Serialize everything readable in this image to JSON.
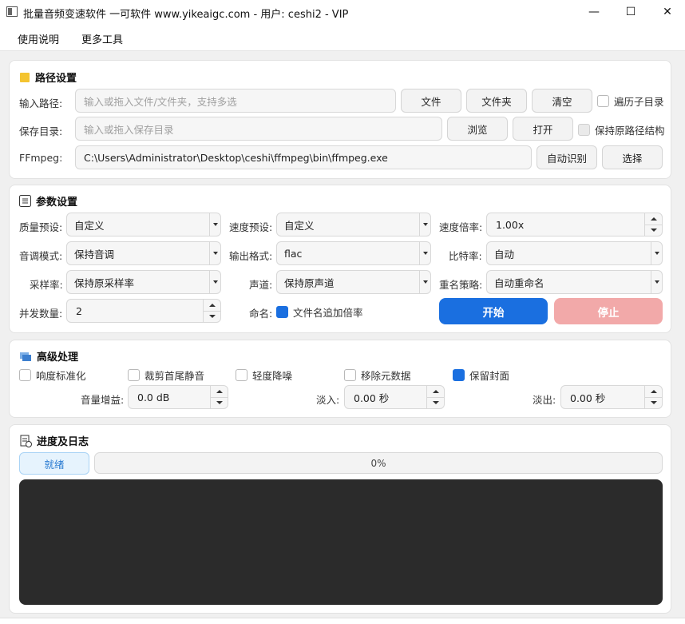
{
  "window": {
    "title": "批量音频变速软件 一可软件 www.yikeaigc.com - 用户: ceshi2 - VIP",
    "minimize": "—",
    "maximize": "☐",
    "close": "✕"
  },
  "menu": {
    "items": [
      "使用说明",
      "更多工具"
    ]
  },
  "path": {
    "title": "路径设置",
    "input_label": "输入路径:",
    "input_placeholder": "输入或拖入文件/文件夹，支持多选",
    "file_btn": "文件",
    "folder_btn": "文件夹",
    "clear_btn": "清空",
    "recursive_label": "遍历子目录",
    "recursive_checked": false,
    "save_label": "保存目录:",
    "save_placeholder": "输入或拖入保存目录",
    "browse_btn": "浏览",
    "open_btn": "打开",
    "keep_structure_label": "保持原路径结构",
    "keep_structure_checked": false,
    "ffmpeg_label": "FFmpeg:",
    "ffmpeg_value": "C:\\Users\\Administrator\\Desktop\\ceshi\\ffmpeg\\bin\\ffmpeg.exe",
    "auto_detect_btn": "自动识别",
    "choose_btn": "选择"
  },
  "params": {
    "title": "参数设置",
    "quality_label": "质量预设:",
    "quality_value": "自定义",
    "speed_preset_label": "速度预设:",
    "speed_preset_value": "自定义",
    "speed_ratio_label": "速度倍率:",
    "speed_ratio_value": "1.00x",
    "pitch_label": "音调模式:",
    "pitch_value": "保持音调",
    "format_label": "输出格式:",
    "format_value": "flac",
    "bitrate_label": "比特率:",
    "bitrate_value": "自动",
    "samplerate_label": "采样率:",
    "samplerate_value": "保持原采样率",
    "channel_label": "声道:",
    "channel_value": "保持原声道",
    "rename_label": "重名策略:",
    "rename_value": "自动重命名",
    "concurrency_label": "并发数量:",
    "concurrency_value": "2",
    "naming_label": "命名:",
    "naming_option_label": "文件名追加倍率",
    "naming_option_checked": true,
    "start_btn": "开始",
    "stop_btn": "停止"
  },
  "advanced": {
    "title": "高级处理",
    "options": [
      {
        "label": "响度标准化",
        "checked": false
      },
      {
        "label": "裁剪首尾静音",
        "checked": false
      },
      {
        "label": "轻度降噪",
        "checked": false
      },
      {
        "label": "移除元数据",
        "checked": false
      },
      {
        "label": "保留封面",
        "checked": true
      }
    ],
    "gain_label": "音量增益:",
    "gain_value": "0.0 dB",
    "fadein_label": "淡入:",
    "fadein_value": "0.00 秒",
    "fadeout_label": "淡出:",
    "fadeout_value": "0.00 秒"
  },
  "progress": {
    "title": "进度及日志",
    "status": "就绪",
    "percent": 0,
    "percent_text": "0%"
  },
  "colors": {
    "accent": "#1a6fe0",
    "stop_disabled": "#f2a9a9",
    "log_bg": "#2b2b2b"
  }
}
